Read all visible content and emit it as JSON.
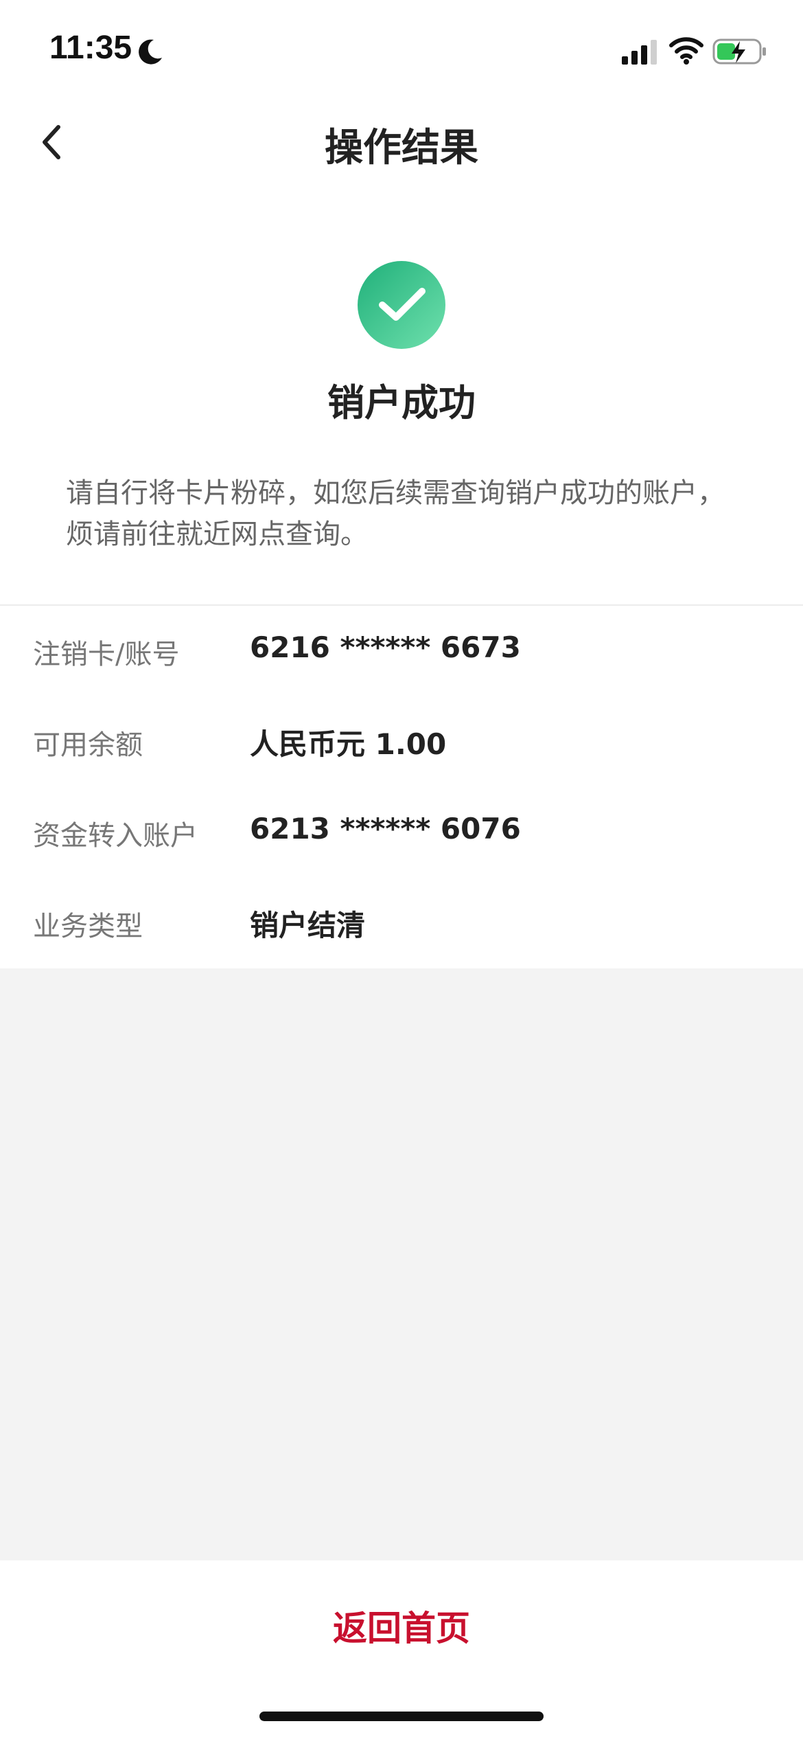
{
  "status_bar": {
    "time": "11:35",
    "icons": [
      "moon-icon",
      "cellular-signal-icon",
      "wifi-icon",
      "battery-charging-icon"
    ]
  },
  "nav": {
    "title": "操作结果",
    "back_icon": "chevron-left-icon"
  },
  "result": {
    "icon": "check-circle-icon",
    "title": "销户成功",
    "note": "请自行将卡片粉碎，如您后续需查询销户成功的账户，烦请前往就近网点查询。"
  },
  "details": [
    {
      "label": "注销卡/账号",
      "value": "6216 ****** 6673"
    },
    {
      "label": "可用余额",
      "value": "人民币元 1.00"
    },
    {
      "label": "资金转入账户",
      "value": "6213 ****** 6076"
    },
    {
      "label": "业务类型",
      "value": "销户结清"
    }
  ],
  "footer": {
    "home_label": "返回首页"
  },
  "colors": {
    "accent": "#c8102e",
    "success_start": "#20b07a",
    "success_end": "#6fe0ad",
    "battery": "#34c759"
  }
}
